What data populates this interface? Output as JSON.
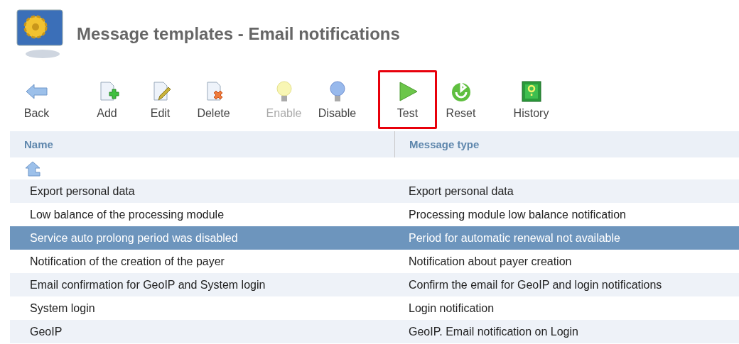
{
  "title": "Message templates - Email notifications",
  "toolbar": [
    [
      {
        "kind": "back",
        "label": "Back",
        "disabled": false,
        "highlighted": false
      }
    ],
    [
      {
        "kind": "add",
        "label": "Add",
        "disabled": false,
        "highlighted": false
      },
      {
        "kind": "edit",
        "label": "Edit",
        "disabled": false,
        "highlighted": false
      },
      {
        "kind": "delete",
        "label": "Delete",
        "disabled": false,
        "highlighted": false
      }
    ],
    [
      {
        "kind": "enable",
        "label": "Enable",
        "disabled": true,
        "highlighted": false
      },
      {
        "kind": "disable",
        "label": "Disable",
        "disabled": false,
        "highlighted": false
      }
    ],
    [
      {
        "kind": "test",
        "label": "Test",
        "disabled": false,
        "highlighted": true
      },
      {
        "kind": "reset",
        "label": "Reset",
        "disabled": false,
        "highlighted": false
      }
    ],
    [
      {
        "kind": "history",
        "label": "History",
        "disabled": false,
        "highlighted": false
      }
    ]
  ],
  "table": {
    "columns": [
      "Name",
      "Message type"
    ],
    "rows": [
      {
        "cells": [
          "Export personal data",
          "Export personal data"
        ],
        "selected": false
      },
      {
        "cells": [
          "Low balance of the processing module",
          "Processing module low balance notification"
        ],
        "selected": false
      },
      {
        "cells": [
          "Service auto prolong period was disabled",
          "Period for automatic renewal not available"
        ],
        "selected": true
      },
      {
        "cells": [
          "Notification of the creation of the payer",
          "Notification about payer creation"
        ],
        "selected": false
      },
      {
        "cells": [
          "Email confirmation for GeoIP and System login",
          "Confirm the email for GeoIP and login notifications"
        ],
        "selected": false
      },
      {
        "cells": [
          "System login",
          "Login notification"
        ],
        "selected": false
      },
      {
        "cells": [
          "GeoIP",
          "GeoIP. Email notification on Login"
        ],
        "selected": false
      }
    ]
  }
}
